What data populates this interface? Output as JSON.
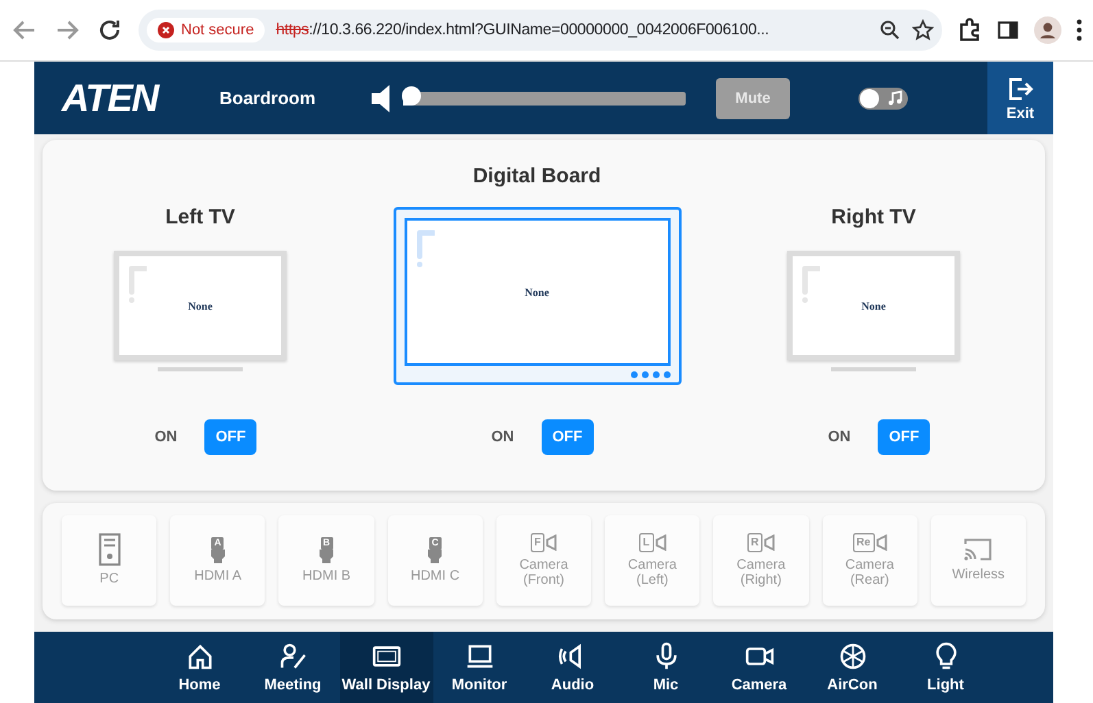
{
  "browser": {
    "security_label": "Not secure",
    "url_scheme": "https",
    "url_rest": "://10.3.66.220/index.html?GUIName=00000000_0042006F006100..."
  },
  "header": {
    "logo": "ATEN",
    "room": "Boardroom",
    "volume": {
      "level": 0.03
    },
    "mute_button": "Mute",
    "music_toggle": {
      "on": false
    },
    "exit_label": "Exit"
  },
  "displays": [
    {
      "title": "Left TV",
      "kind": "tv",
      "source": "None",
      "on_label": "ON",
      "off_label": "OFF",
      "power_on": false
    },
    {
      "title": "Digital Board",
      "kind": "board",
      "source": "None",
      "on_label": "ON",
      "off_label": "OFF",
      "power_on": false
    },
    {
      "title": "Right TV",
      "kind": "tv",
      "source": "None",
      "on_label": "ON",
      "off_label": "OFF",
      "power_on": false
    }
  ],
  "sources": [
    {
      "kind": "pc",
      "label": "PC"
    },
    {
      "kind": "hdmi",
      "letter": "A",
      "label": "HDMI A"
    },
    {
      "kind": "hdmi",
      "letter": "B",
      "label": "HDMI B"
    },
    {
      "kind": "hdmi",
      "letter": "C",
      "label": "HDMI C"
    },
    {
      "kind": "camera",
      "letter": "F",
      "label": "Camera (Front)"
    },
    {
      "kind": "camera",
      "letter": "L",
      "label": "Camera (Left)"
    },
    {
      "kind": "camera",
      "letter": "R",
      "label": "Camera (Right)"
    },
    {
      "kind": "camera",
      "letter": "Re",
      "label": "Camera (Rear)"
    },
    {
      "kind": "wireless",
      "label": "Wireless"
    }
  ],
  "nav": [
    {
      "kind": "home",
      "label": "Home",
      "selected": false
    },
    {
      "kind": "meeting",
      "label": "Meeting",
      "selected": false
    },
    {
      "kind": "display",
      "label": "Wall Display",
      "selected": true
    },
    {
      "kind": "monitor",
      "label": "Monitor",
      "selected": false
    },
    {
      "kind": "audio",
      "label": "Audio",
      "selected": false
    },
    {
      "kind": "mic",
      "label": "Mic",
      "selected": false
    },
    {
      "kind": "camera",
      "label": "Camera",
      "selected": false
    },
    {
      "kind": "aircon",
      "label": "AirCon",
      "selected": false
    },
    {
      "kind": "light",
      "label": "Light",
      "selected": false
    }
  ]
}
